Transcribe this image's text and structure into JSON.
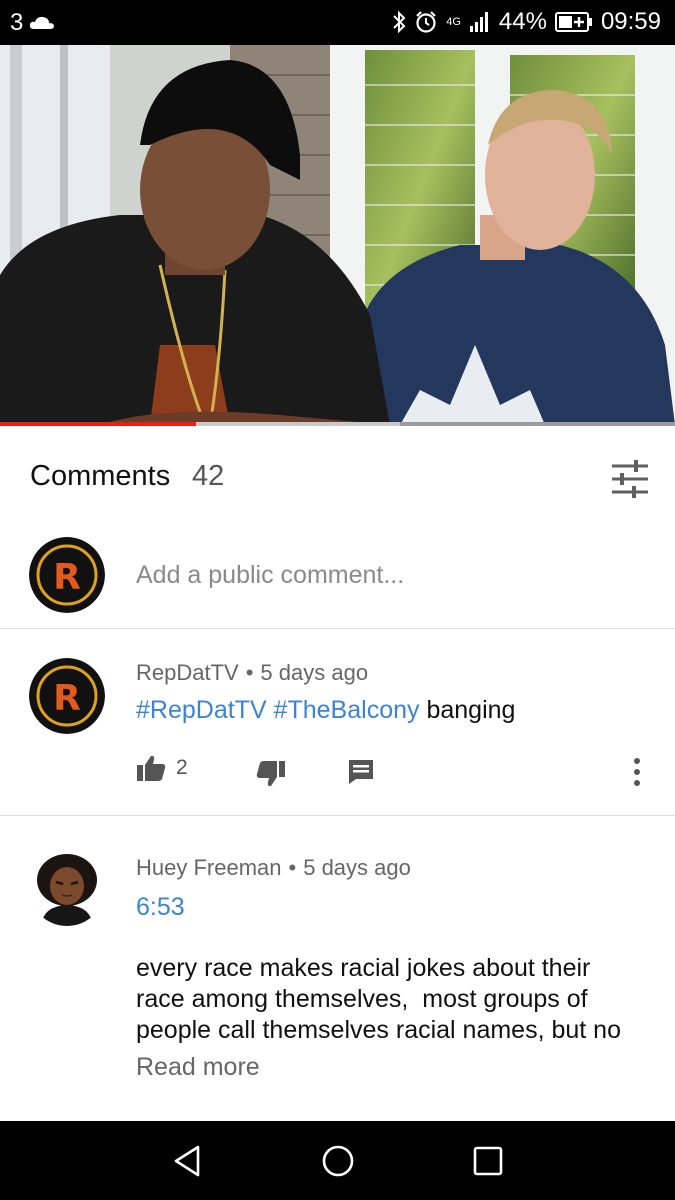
{
  "status_bar": {
    "notification_count": "3",
    "network": "4G",
    "battery": "44%",
    "time": "09:59",
    "icons": [
      "cloud-icon",
      "bluetooth-icon",
      "alarm-icon",
      "signal-icon",
      "battery-icon"
    ]
  },
  "video": {
    "progress_fraction": 0.29,
    "colors": {
      "played": "#e62117",
      "track": "#9a9a9a"
    }
  },
  "comments": {
    "title": "Comments",
    "count": "42",
    "sort_icon": "sort-filter-icon",
    "add_placeholder": "Add a public comment...",
    "items": [
      {
        "author": "RepDatTV",
        "separator": "•",
        "time": "5 days ago",
        "hashtags": [
          "#RepDatTV",
          "#TheBalcony"
        ],
        "text": "banging",
        "likes": "2"
      },
      {
        "author": "Huey Freeman",
        "separator": "•",
        "time": "5 days ago",
        "timestamp_link": "6:53",
        "text_lines": [
          "every race makes racial jokes about their",
          "race among themselves,  most groups of",
          "people call themselves racial names, but no"
        ],
        "read_more": "Read more"
      }
    ]
  },
  "colors": {
    "link": "#3d83d4",
    "secondary_text": "#666666"
  },
  "nav_bar": {
    "icons": [
      "back-icon",
      "home-icon",
      "recents-icon"
    ]
  }
}
